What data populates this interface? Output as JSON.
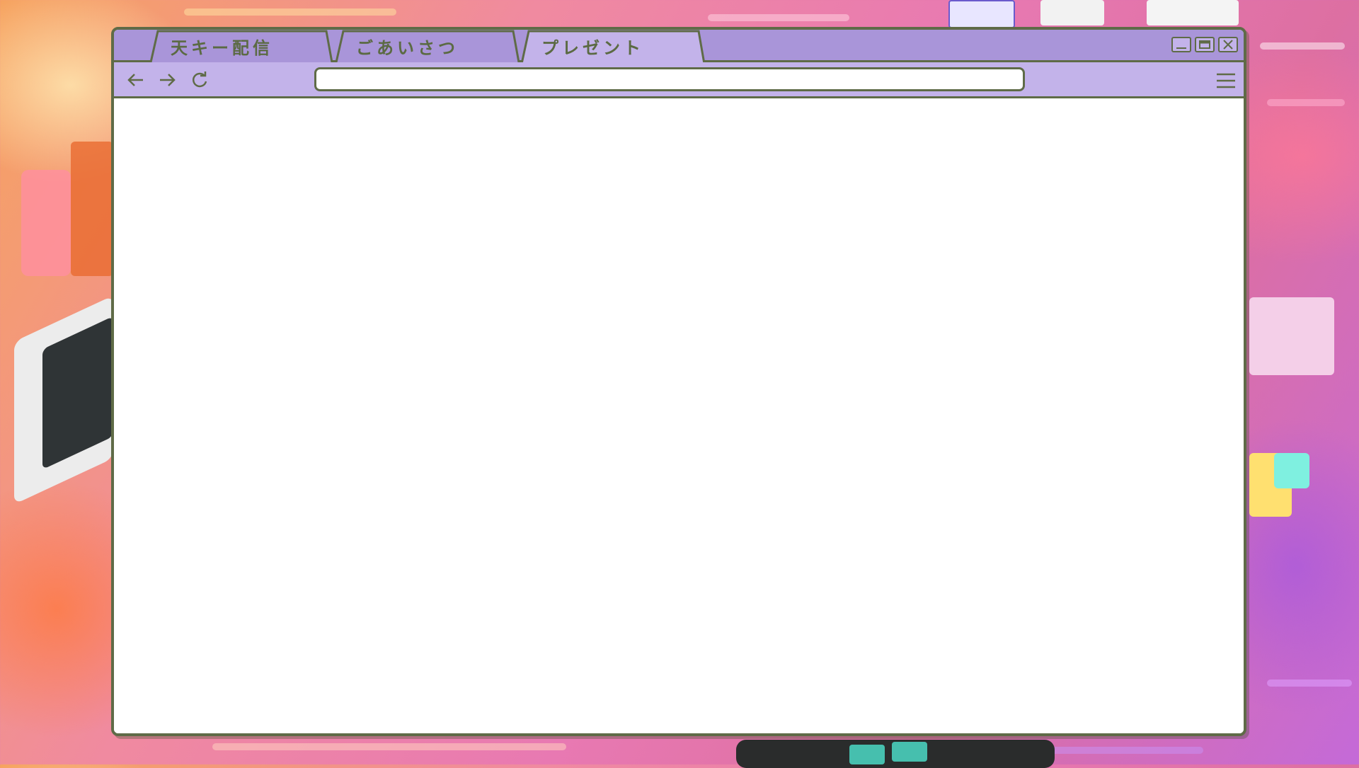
{
  "tabs": [
    {
      "label": "天キー配信",
      "active": false
    },
    {
      "label": "ごあいさつ",
      "active": false
    },
    {
      "label": "プレゼント",
      "active": true
    }
  ],
  "address_bar": {
    "value": "",
    "placeholder": ""
  },
  "colors": {
    "titlebar": "#a995d9",
    "toolbar": "#c3b3ea",
    "active_tab": "#c3b3ea",
    "border": "#5f6b47",
    "content": "#ffffff"
  },
  "icons": [
    "arrow-left-icon",
    "arrow-right-icon",
    "refresh-icon",
    "hamburger-menu-icon",
    "minimize-icon",
    "maximize-icon",
    "close-icon"
  ]
}
